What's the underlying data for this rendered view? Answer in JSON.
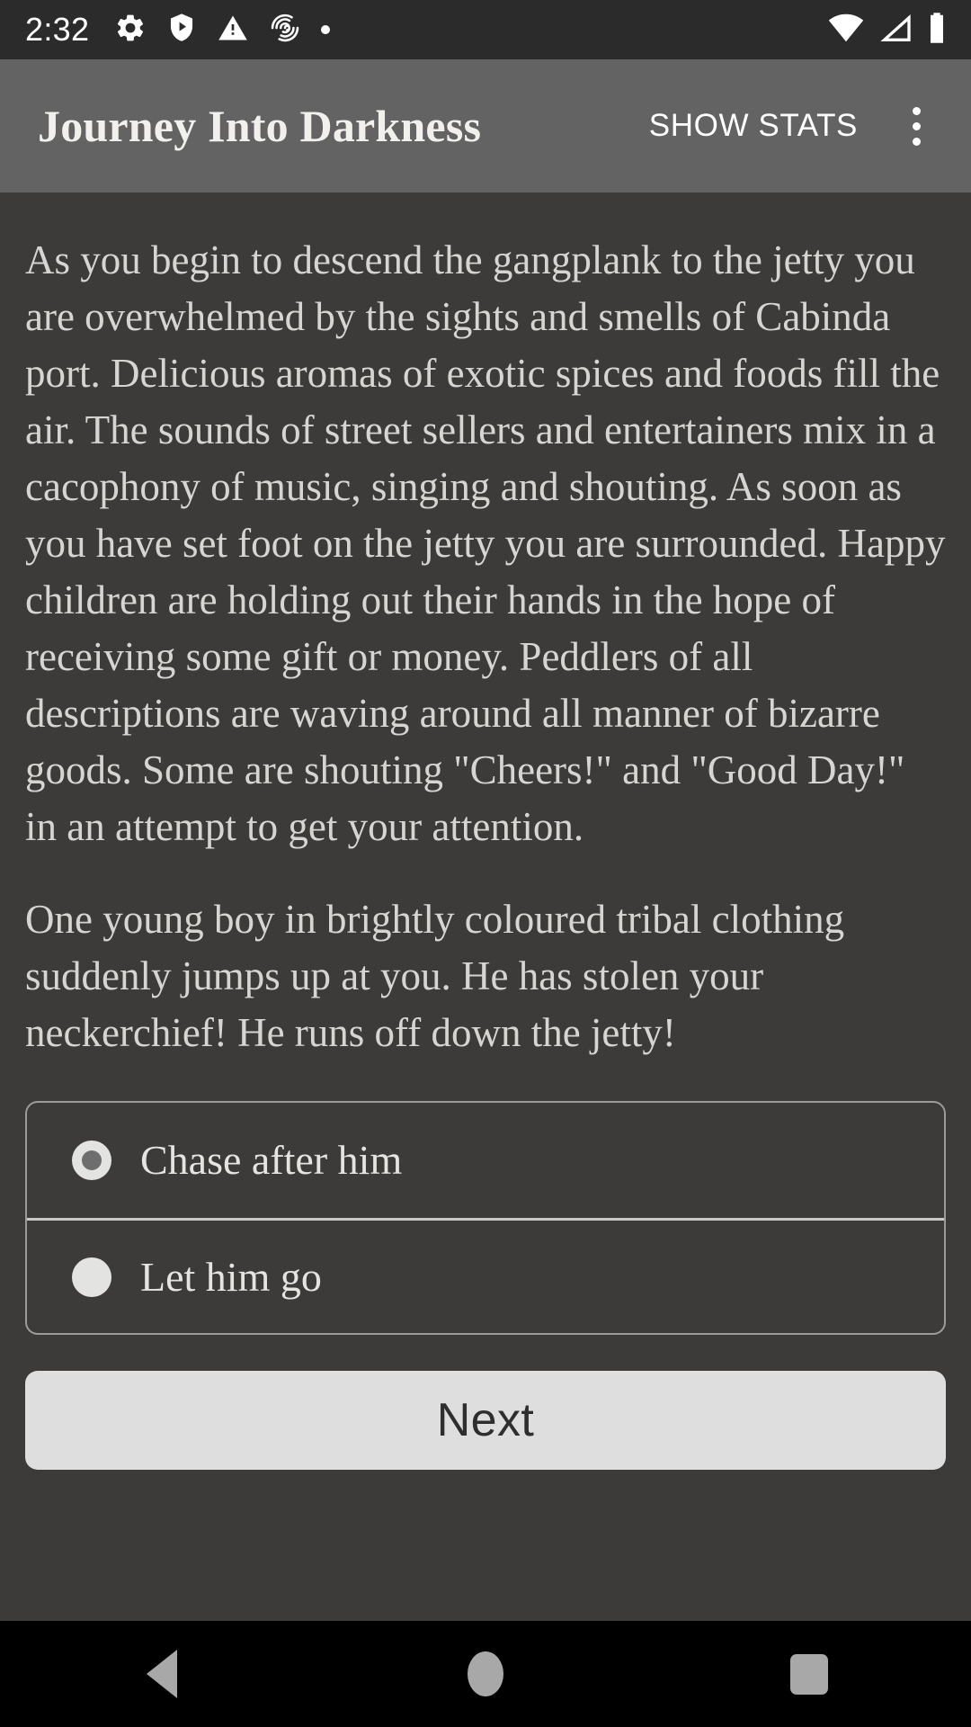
{
  "status_bar": {
    "time": "2:32",
    "left_icons": [
      "gear-icon",
      "shield-play-icon",
      "warning-triangle-icon",
      "fingerprint-icon",
      "dot-icon"
    ],
    "right_icons": [
      "wifi-icon",
      "cell-signal-icon",
      "battery-icon"
    ],
    "background_color": "#2b2b2b"
  },
  "app_bar": {
    "title": "Journey Into Darkness",
    "action_label": "SHOW STATS",
    "overflow_icon": "more-vert-icon",
    "background_color": "#636363"
  },
  "story": {
    "paragraphs": [
      "As you begin to descend the gangplank to the jetty you are overwhelmed by the sights and smells of Cabinda port. Delicious aromas of exotic spices and foods fill the air. The sounds of street sellers and entertainers mix in a cacophony of music, singing and shouting. As soon as you have set foot on the jetty you are surrounded. Happy children are holding out their hands in the hope of receiving some gift or money. Peddlers of all descriptions are waving around all manner of bizarre goods. Some are shouting \"Cheers!\" and \"Good Day!\" in an attempt to get your attention.",
      "One young boy in brightly coloured tribal clothing suddenly jumps up at you. He has stolen your neckerchief! He runs off down the jetty!"
    ],
    "text_color": "#d7d5d1",
    "background_color": "#3c3b39"
  },
  "choices": {
    "options": [
      {
        "label": "Chase after him",
        "selected": true
      },
      {
        "label": "Let him go",
        "selected": false
      }
    ]
  },
  "next_button": {
    "label": "Next",
    "background_color": "#dedede",
    "text_color": "#2e2e2e"
  },
  "nav_bar": {
    "back_icon": "back-triangle-icon",
    "home_icon": "home-circle-icon",
    "recents_icon": "recents-square-icon",
    "background_color": "#000000"
  }
}
